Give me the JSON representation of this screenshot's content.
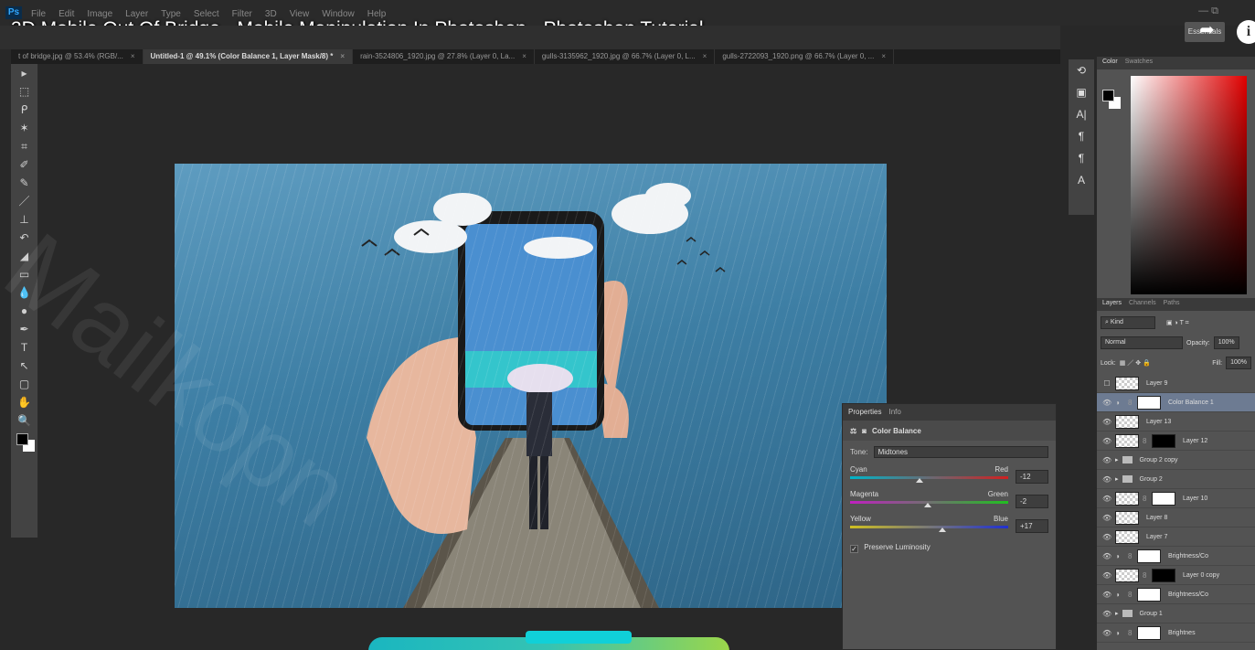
{
  "app": {
    "logo": "Ps",
    "menus": [
      "File",
      "Edit",
      "Image",
      "Layer",
      "Type",
      "Select",
      "Filter",
      "3D",
      "View",
      "Window",
      "Help"
    ],
    "workspace_button": "Essentials"
  },
  "video": {
    "title": "3D Mobile Out Of Bridge - Mobile Manipulation In Photoshop - Photoshop Tutorial",
    "info_icon": "i"
  },
  "tabs": [
    {
      "label": "t of bridge.jpg @ 53.4% (RGB/...",
      "active": false
    },
    {
      "label": "Untitled-1 @ 49.1% (Color Balance 1, Layer Mask/8) *",
      "active": true
    },
    {
      "label": "rain-3524806_1920.jpg @ 27.8% (Layer 0, La...",
      "active": false
    },
    {
      "label": "gulls-3135962_1920.jpg @ 66.7% (Layer 0, L...",
      "active": false
    },
    {
      "label": "gulls-2722093_1920.png @ 66.7% (Layer 0, ...",
      "active": false
    }
  ],
  "tools": [
    "move-icon",
    "marquee-icon",
    "lasso-icon",
    "magic-wand-icon",
    "crop-icon",
    "eyedropper-icon",
    "healing-brush-icon",
    "brush-icon",
    "clone-stamp-icon",
    "history-brush-icon",
    "eraser-icon",
    "gradient-icon",
    "blur-icon",
    "dodge-icon",
    "pen-icon",
    "type-icon",
    "path-selection-icon",
    "shape-icon",
    "hand-icon",
    "zoom-icon"
  ],
  "tool_glyphs": [
    "▸",
    "⬚",
    "ᑭ",
    "✶",
    "⌗",
    "✐",
    "✎",
    "／",
    "⊥",
    "↶",
    "◢",
    "▭",
    "💧",
    "●",
    "✒",
    "T",
    "↖",
    "▢",
    "✋",
    "🔍"
  ],
  "properties": {
    "tabs": [
      "Properties",
      "Info"
    ],
    "title": "Color Balance",
    "tone_label": "Tone:",
    "tone_value": "Midtones",
    "sliders": [
      {
        "left": "Cyan",
        "right": "Red",
        "value": "-12",
        "fraction": 0.44,
        "colors": [
          "#00b4c8",
          "#d02020"
        ]
      },
      {
        "left": "Magenta",
        "right": "Green",
        "value": "-2",
        "fraction": 0.49,
        "colors": [
          "#c020c0",
          "#20c020"
        ]
      },
      {
        "left": "Yellow",
        "right": "Blue",
        "value": "+17",
        "fraction": 0.585,
        "colors": [
          "#d0c020",
          "#2030d0"
        ]
      }
    ],
    "preserve_label": "Preserve Luminosity",
    "preserve_checked": true
  },
  "color_panel": {
    "tabs": [
      "Color",
      "Swatches"
    ],
    "hue": "#e00000"
  },
  "layers_panel": {
    "tabs": [
      "Layers",
      "Channels",
      "Paths"
    ],
    "filter": "Kind",
    "blend_mode": "Normal",
    "opacity_label": "Opacity:",
    "opacity_value": "100%",
    "lock_label": "Lock:",
    "fill_label": "Fill:",
    "fill_value": "100%",
    "layers": [
      {
        "name": "Layer 9",
        "visible": false,
        "kind": "pixel"
      },
      {
        "name": "Color Balance 1",
        "visible": true,
        "kind": "adjustment",
        "selected": true
      },
      {
        "name": "Layer 13",
        "visible": true,
        "kind": "pixel"
      },
      {
        "name": "Layer 12",
        "visible": true,
        "kind": "pixel-mask-black"
      },
      {
        "name": "Group 2 copy",
        "visible": true,
        "kind": "group"
      },
      {
        "name": "Group 2",
        "visible": true,
        "kind": "group"
      },
      {
        "name": "Layer 10",
        "visible": true,
        "kind": "pixel-mask"
      },
      {
        "name": "Layer 8",
        "visible": true,
        "kind": "pixel"
      },
      {
        "name": "Layer 7",
        "visible": true,
        "kind": "pixel"
      },
      {
        "name": "Brightness/Co",
        "visible": true,
        "kind": "adjustment"
      },
      {
        "name": "Layer 0 copy",
        "visible": true,
        "kind": "pixel-mask-black"
      },
      {
        "name": "Brightness/Co",
        "visible": true,
        "kind": "adjustment"
      },
      {
        "name": "Group 1",
        "visible": true,
        "kind": "group"
      },
      {
        "name": "Brightnes",
        "visible": true,
        "kind": "adjustment"
      }
    ]
  },
  "watermark": "Mailkopn"
}
